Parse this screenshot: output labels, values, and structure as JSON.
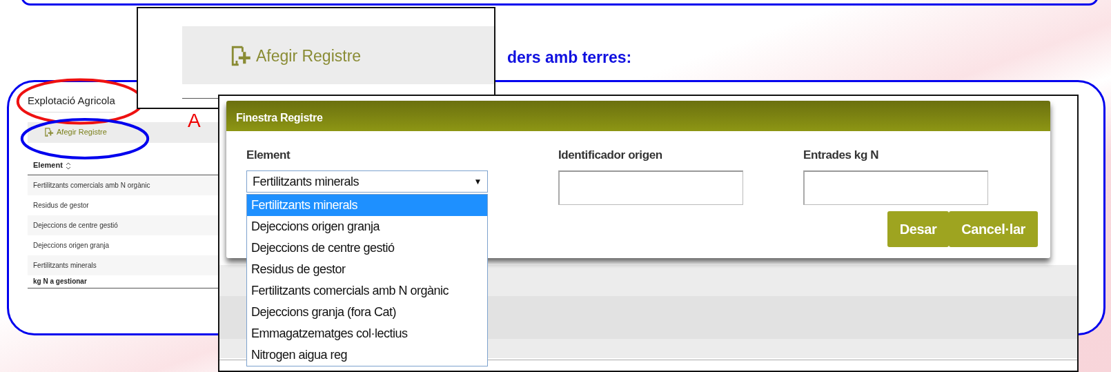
{
  "heading": "ders amb terres:",
  "callout": {
    "button": "Afegir Registre"
  },
  "panel": {
    "title": "Explotació Agricola",
    "overlay_text": "A",
    "add_button": "Afegir Registre",
    "table": {
      "columns": [
        "Element"
      ],
      "rows": [
        "Fertilitzants comercials amb N orgànic",
        "Residus de gestor",
        "Dejeccions de centre gestió",
        "Dejeccions origen granja",
        "Fertilitzants minerals"
      ],
      "footer": "kg N a gestionar"
    }
  },
  "dialog": {
    "title": "Finestra Registre",
    "fields": [
      {
        "label": "Element",
        "kind": "select",
        "value": "Fertilitzants minerals",
        "caret": "▼",
        "expanded": true,
        "options": [
          {
            "label": "Fertilitzants minerals",
            "selected": true
          },
          {
            "label": "Dejeccions origen granja",
            "selected": false
          },
          {
            "label": "Dejeccions de centre gestió",
            "selected": false
          },
          {
            "label": "Residus de gestor",
            "selected": false
          },
          {
            "label": "Fertilitzants comercials amb N orgànic",
            "selected": false
          },
          {
            "label": "Dejeccions granja (fora Cat)",
            "selected": false
          },
          {
            "label": "Emmagatzematges col·lectius",
            "selected": false
          },
          {
            "label": "Nitrogen aigua reg",
            "selected": false
          }
        ]
      },
      {
        "label": "Identificador origen",
        "kind": "text"
      },
      {
        "label": "Entrades kg N",
        "kind": "text"
      }
    ],
    "buttons": [
      "Desar",
      "Cancel·lar"
    ]
  }
}
